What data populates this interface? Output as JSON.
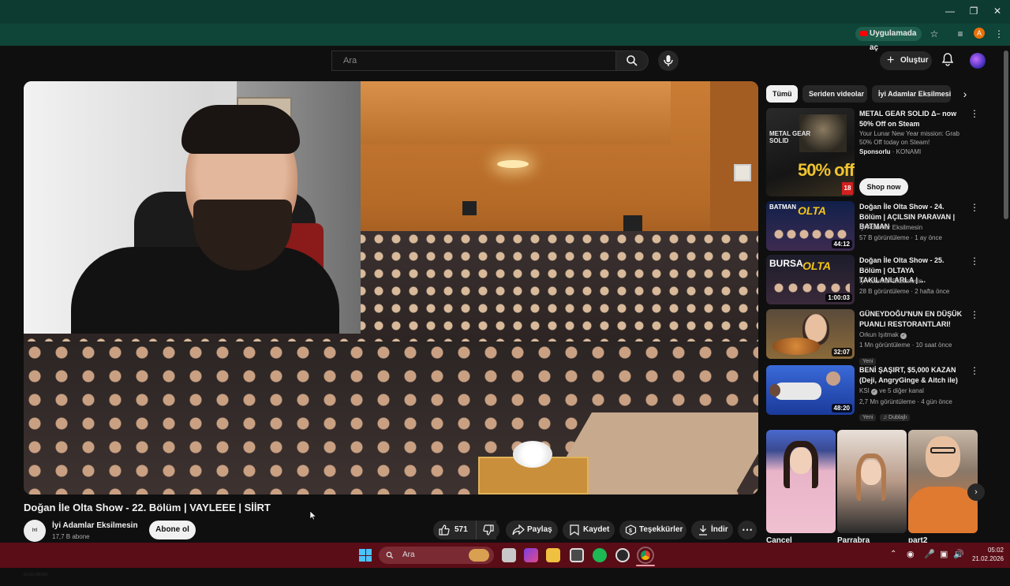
{
  "browser": {
    "open_in_app": "Uygulamada aç",
    "profile_initial": "A"
  },
  "header": {
    "search_placeholder": "Ara",
    "create_label": "Oluştur"
  },
  "video": {
    "title": "Doğan İle Olta Show - 22. Bölüm | VAYLEEE | SİİRT",
    "channel_name": "İyi Adamlar Eksilmesin",
    "channel_logo_text": "İYİ ADAMLAR EKSİLMESİN",
    "subscribers": "17,7 B abone",
    "subscribe_label": "Abone ol",
    "like_count": "571",
    "share_label": "Paylaş",
    "save_label": "Kaydet",
    "thanks_label": "Teşekkürler",
    "download_label": "İndir"
  },
  "chips": [
    "Tümü",
    "Seriden videolar",
    "İyi Adamlar Eksilmesin"
  ],
  "ad": {
    "title": "METAL GEAR SOLID Δ– now 50% Off on Steam",
    "description": "Your Lunar New Year mission: Grab 50% Off today on Steam!",
    "sponsor_label": "Sponsorlu",
    "sponsor_name": "KONAMI",
    "cta": "Shop now",
    "thumb_text": "METAL GEAR SOLID",
    "thumb_offer": "50% off",
    "rating": "18"
  },
  "recommendations": [
    {
      "title": "Doğan İle Olta Show - 24. Bölüm | AÇILSIN PARAVAN | BATMAN",
      "channel": "İyi Adamlar Eksilmesin",
      "meta": "57 B görüntüleme · 1 ay önce",
      "duration": "44:12",
      "thumb_word": "BATMAN"
    },
    {
      "title": "Doğan İle Olta Show - 25. Bölüm | OLTAYA TAKILANLARLA | ...",
      "channel": "İyi Adamlar Eksilmesin",
      "meta": "28 B görüntüleme · 2 hafta önce",
      "duration": "1:00:03",
      "thumb_word": "BURSA"
    },
    {
      "title": "GÜNEYDOĞU'NUN EN DÜŞÜK PUANLI RESTORANTLARI!",
      "channel": "Orkun Işıtmak",
      "meta": "1 Mn görüntüleme · 10 saat önce",
      "duration": "32:07",
      "badge": "Yeni"
    },
    {
      "title": "BENİ ŞAŞIRT, $5,000 KAZAN (Deji, AngryGinge & Aitch ile)",
      "channel": "KSI",
      "meta": "2,7 Mn görüntüleme · 4 gün önce",
      "duration": "48:20",
      "channel_extra": "ve 5 diğer kanal",
      "badge": "Yeni",
      "badge2": "Dublajlı"
    }
  ],
  "shorts": [
    "Cancel",
    "Parrabra",
    "part2"
  ],
  "taskbar": {
    "search_placeholder": "Ara",
    "time": "05:02",
    "date": "21.02.2026"
  },
  "colors": {
    "browser_frame": "#0d3b32",
    "youtube_bg": "#0f0f0f",
    "taskbar": "#5a0d16",
    "accent_red": "#ff0000"
  }
}
